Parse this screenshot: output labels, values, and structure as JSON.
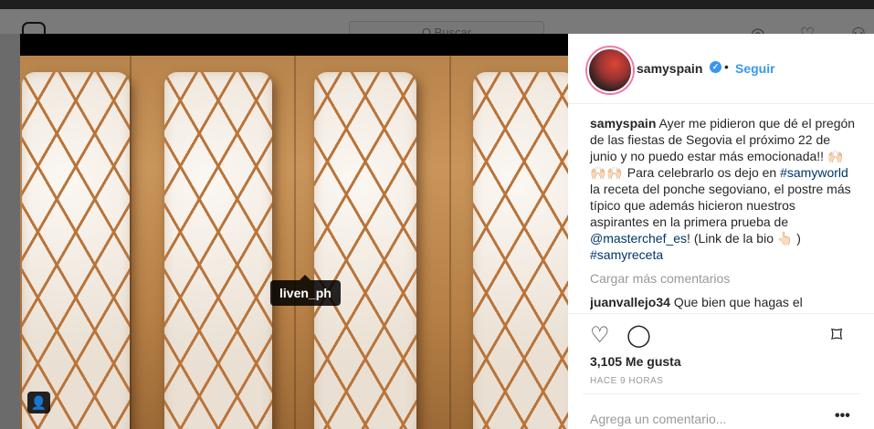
{
  "background": {
    "search_placeholder": "Q Buscar"
  },
  "photo": {
    "tag_label": "liven_ph"
  },
  "post": {
    "username": "samyspain",
    "follow_label": "Seguir",
    "separator": "•",
    "caption_user": "samyspain",
    "caption_part1": "Ayer me pidieron que dé el pregón de las fiestas de Segovia el próximo 22 de junio y no puedo estar más emocionada!!",
    "caption_emoji": "🙌🏻🙌🏻🙌🏻",
    "caption_part2": "Para celebrarlo os dejo en",
    "hashtag1": "#samyworld",
    "caption_part3": "la receta del ponche segoviano, el postre más típico que además hicieron nuestros aspirantes en la primera prueba de",
    "mention": "@masterchef_es",
    "caption_part4": "! (Link de la bio",
    "pointer_emoji": "👆🏻",
    "caption_part5": ")",
    "hashtag2": "#samyreceta",
    "load_more": "Cargar más comentarios",
    "comment_user": "juanvallejo34",
    "comment_text": "Que bien que hagas el",
    "likes": "3,105 Me gusta",
    "time": "HACE 9 HORAS",
    "add_comment_placeholder": "Agrega un comentario...",
    "more_options": "•••"
  },
  "colors": {
    "accent": "#3897f0",
    "text": "#262626",
    "muted": "#999999"
  }
}
